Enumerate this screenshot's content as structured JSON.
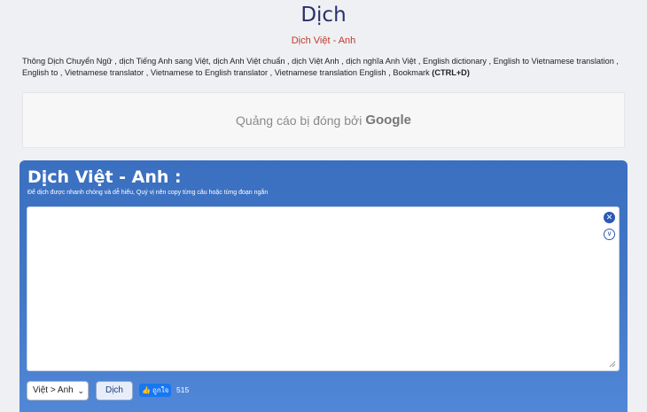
{
  "header": {
    "title": "Dịch",
    "subtitle": "Dịch Việt - Anh"
  },
  "keywords": {
    "items": [
      "Thông Dịch Chuyển Ngữ",
      "dịch Tiếng Anh sang Việt",
      "dịch Anh Việt chuẩn",
      "dịch Việt Anh",
      "dịch nghĩa Anh Việt",
      "English dictionary",
      "English to Vietnamese translation",
      "English to",
      "Vietnamese translator",
      "Vietnamese to English translator",
      "Vietnamese translation English"
    ],
    "bookmark_label": "Bookmark",
    "bookmark_shortcut": "(CTRL+D)"
  },
  "ad": {
    "text": "Quảng cáo bị đóng bởi",
    "brand": "Google"
  },
  "panel": {
    "title": "Dịch Việt - Anh :",
    "hint": "Để dịch được nhanh chóng và dễ hiểu, Quý vị nên copy từng câu hoặc từng đoạn ngắn",
    "input_value": "",
    "clear_icon": "close-icon",
    "expand_icon": "chevron-down-icon"
  },
  "controls": {
    "language_selected": "Việt > Anh",
    "translate_label": "Dịch",
    "like_label": "ถูกใจ",
    "like_count": "515"
  },
  "colors": {
    "panel_top": "#3b6fc0",
    "panel_bottom": "#5288d8",
    "subtitle": "#c0392b",
    "title": "#2b2f6b",
    "facebook": "#1877f2"
  }
}
